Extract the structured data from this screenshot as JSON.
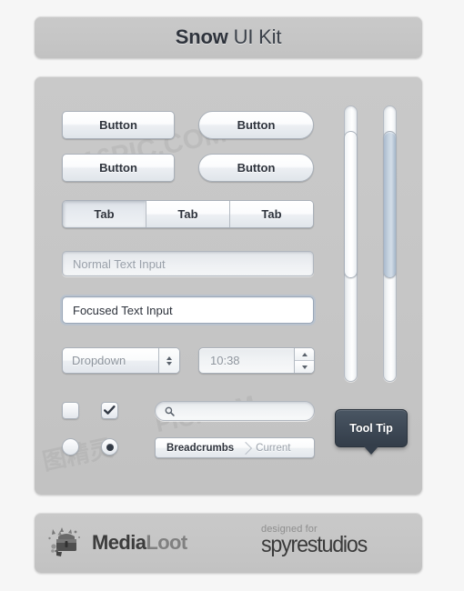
{
  "header": {
    "title_strong": "Snow",
    "title_light": "UI Kit"
  },
  "main": {
    "buttons": [
      {
        "label": "Button",
        "shape": "rect"
      },
      {
        "label": "Button",
        "shape": "pill"
      },
      {
        "label": "Button",
        "shape": "rect"
      },
      {
        "label": "Button",
        "shape": "pill"
      }
    ],
    "tabs": [
      {
        "label": "Tab",
        "active": true
      },
      {
        "label": "Tab",
        "active": false
      },
      {
        "label": "Tab",
        "active": false
      }
    ],
    "inputs": {
      "normal_placeholder": "Normal Text Input",
      "focused_value": "Focused Text Input"
    },
    "dropdown": {
      "label": "Dropdown"
    },
    "time_spinner": {
      "value": "10:38"
    },
    "checkboxes": [
      {
        "name": "unchecked",
        "checked": false
      },
      {
        "name": "checked",
        "checked": true
      }
    ],
    "radios": [
      {
        "name": "unselected",
        "selected": false
      },
      {
        "name": "selected",
        "selected": true
      }
    ],
    "search": {
      "value": "",
      "placeholder": ""
    },
    "breadcrumb": {
      "root": "Breadcrumbs",
      "current": "Current"
    },
    "tooltip": {
      "label": "Tool Tip"
    },
    "sliders": [
      {
        "name": "slider-left",
        "fill": "white"
      },
      {
        "name": "slider-right",
        "fill": "blue"
      }
    ]
  },
  "footer": {
    "medialoot": {
      "part1": "Media",
      "part2": "Loot"
    },
    "spyrestudios": {
      "designed_for": "designed for",
      "name": "spyrestudios"
    }
  },
  "watermarks": {
    "w1": "616PIC.COM",
    "w2": "PIC.COM",
    "w3": "图精灵"
  },
  "colors": {
    "page_bg": "#f6f6f6",
    "panel_bg": "#c6c6c6",
    "text_dark": "#2e333c",
    "text_muted": "#9aa1aa",
    "tooltip_bg": "#3e4956",
    "slider_fill": "#c7d4e1"
  }
}
